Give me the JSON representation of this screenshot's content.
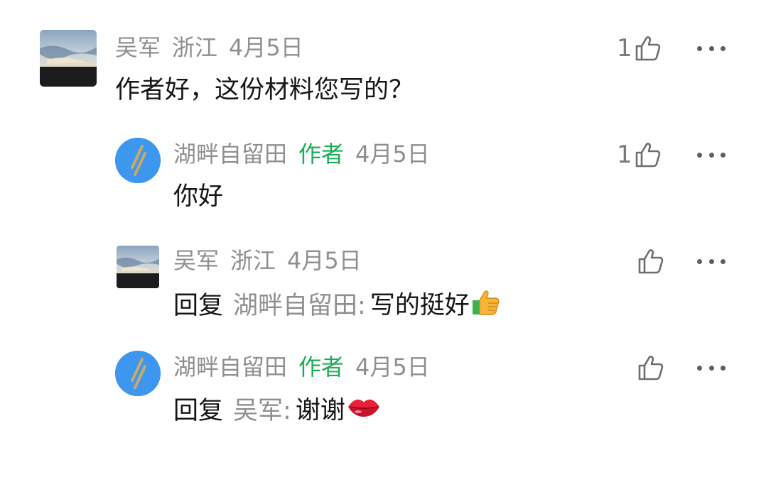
{
  "comments": [
    {
      "user": "吴军",
      "location": "浙江",
      "date": "4月5日",
      "text": "作者好，这份材料您写的？",
      "likes": "1",
      "avatar_icon": "landscape-photo"
    },
    {
      "user": "湖畔自留田",
      "author_tag": "作者",
      "date": "4月5日",
      "text": "你好",
      "likes": "1",
      "avatar_icon": "slash-logo"
    },
    {
      "user": "吴军",
      "location": "浙江",
      "date": "4月5日",
      "reply_prefix": "回复",
      "reply_to": "湖畔自留田:",
      "text": "写的挺好",
      "emoji": "thumbs-up-emoji",
      "avatar_icon": "landscape-photo"
    },
    {
      "user": "湖畔自留田",
      "author_tag": "作者",
      "date": "4月5日",
      "reply_prefix": "回复",
      "reply_to": "吴军:",
      "text": "谢谢",
      "emoji": "lips-emoji",
      "avatar_icon": "slash-logo"
    }
  ],
  "icons": {
    "like": "thumbs-up-outline-icon",
    "more": "more-dots-icon"
  },
  "colors": {
    "author_tag": "#1aad55",
    "meta_text": "#8f8f8f",
    "body_text": "#161616",
    "avatar_blue": "#3d97ee"
  }
}
